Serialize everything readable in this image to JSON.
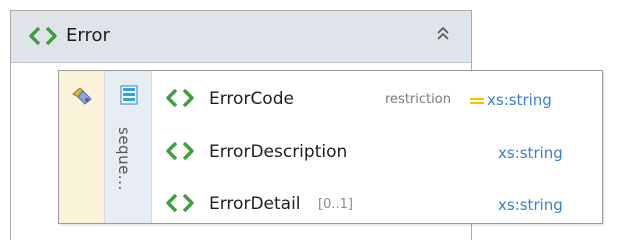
{
  "complex_type": {
    "name": "Error",
    "icon": "element-brackets-icon",
    "collapse_icon": "double-chevron-up-icon"
  },
  "model_group": {
    "compositor_icon": "compositor-icon",
    "sequence_icon": "sequence-icon",
    "label": "seque..."
  },
  "elements": [
    {
      "name": "ErrorCode",
      "occurs": "",
      "restriction": "restriction",
      "type": "xs:string"
    },
    {
      "name": "ErrorDescription",
      "occurs": "",
      "restriction": "",
      "type": "xs:string"
    },
    {
      "name": "ErrorDetail",
      "occurs": "[0..1]",
      "restriction": "",
      "type": "xs:string"
    }
  ],
  "colors": {
    "element_icon": "#3f9d3f",
    "type_link": "#3a7fd0",
    "restriction_marker": "#f2c200",
    "header_bg": "#dfe3ea",
    "compositor_bg": "#fbf3d9",
    "sequence_bg": "#e8edf4"
  }
}
